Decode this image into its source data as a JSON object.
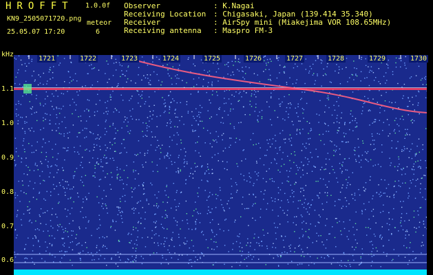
{
  "app": {
    "title": "HROFFT",
    "version": "1.0.0f"
  },
  "file": {
    "name": "KN9_2505071720.png",
    "datetime": "25.05.07 17:20"
  },
  "meteor": {
    "label": "meteor",
    "count": "6"
  },
  "info": [
    {
      "label": "Observer",
      "value": ": K.Nagai"
    },
    {
      "label": "Receiving Location",
      "value": ": Chigasaki, Japan (139.414 35.340)"
    },
    {
      "label": "Receiver",
      "value": ": AirSpy mini (Miakejima VOR 108.65MHz)"
    },
    {
      "label": "Receiving antenna",
      "value": ": Maspro FM-3"
    }
  ],
  "spectrogram": {
    "y_unit": "kHz",
    "x_ticks": [
      "1721",
      "1722",
      "1723",
      "1724",
      "1725",
      "1726",
      "1727",
      "1728",
      "1729",
      "1730"
    ],
    "y_ticks": [
      "1.1",
      "1.0",
      "0.9",
      "0.8",
      "0.7",
      "0.6"
    ],
    "colors": {
      "background": "#1a2a8c",
      "noise": "#6fa0ff",
      "carrier": "#ff4060",
      "floor": "#00e5ff",
      "label": "#ffff66"
    }
  }
}
